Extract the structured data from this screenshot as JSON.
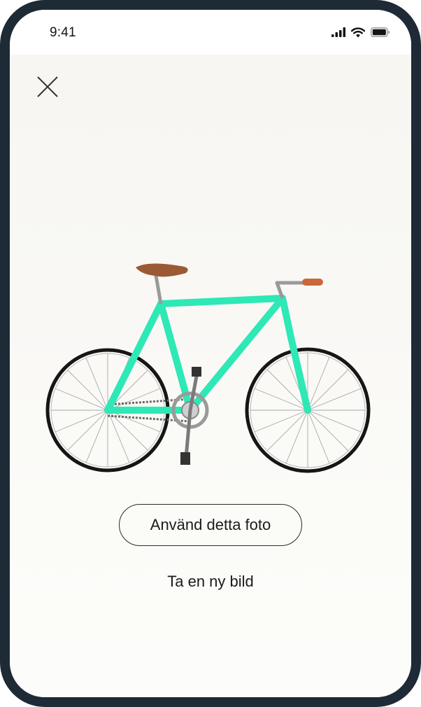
{
  "status_bar": {
    "time": "9:41",
    "icons": [
      "signal-icon",
      "wifi-icon",
      "battery-icon"
    ]
  },
  "toolbar": {
    "close_icon": "close-icon"
  },
  "photo": {
    "subject": "bicycle-photo",
    "frame_color": "#2ee8b5",
    "saddle_color": "#9b5a35"
  },
  "actions": {
    "use_photo_label": "Använd detta foto",
    "retake_label": "Ta en ny bild"
  },
  "colors": {
    "device_frame": "#1e2a36",
    "text": "#1c1c1c"
  }
}
